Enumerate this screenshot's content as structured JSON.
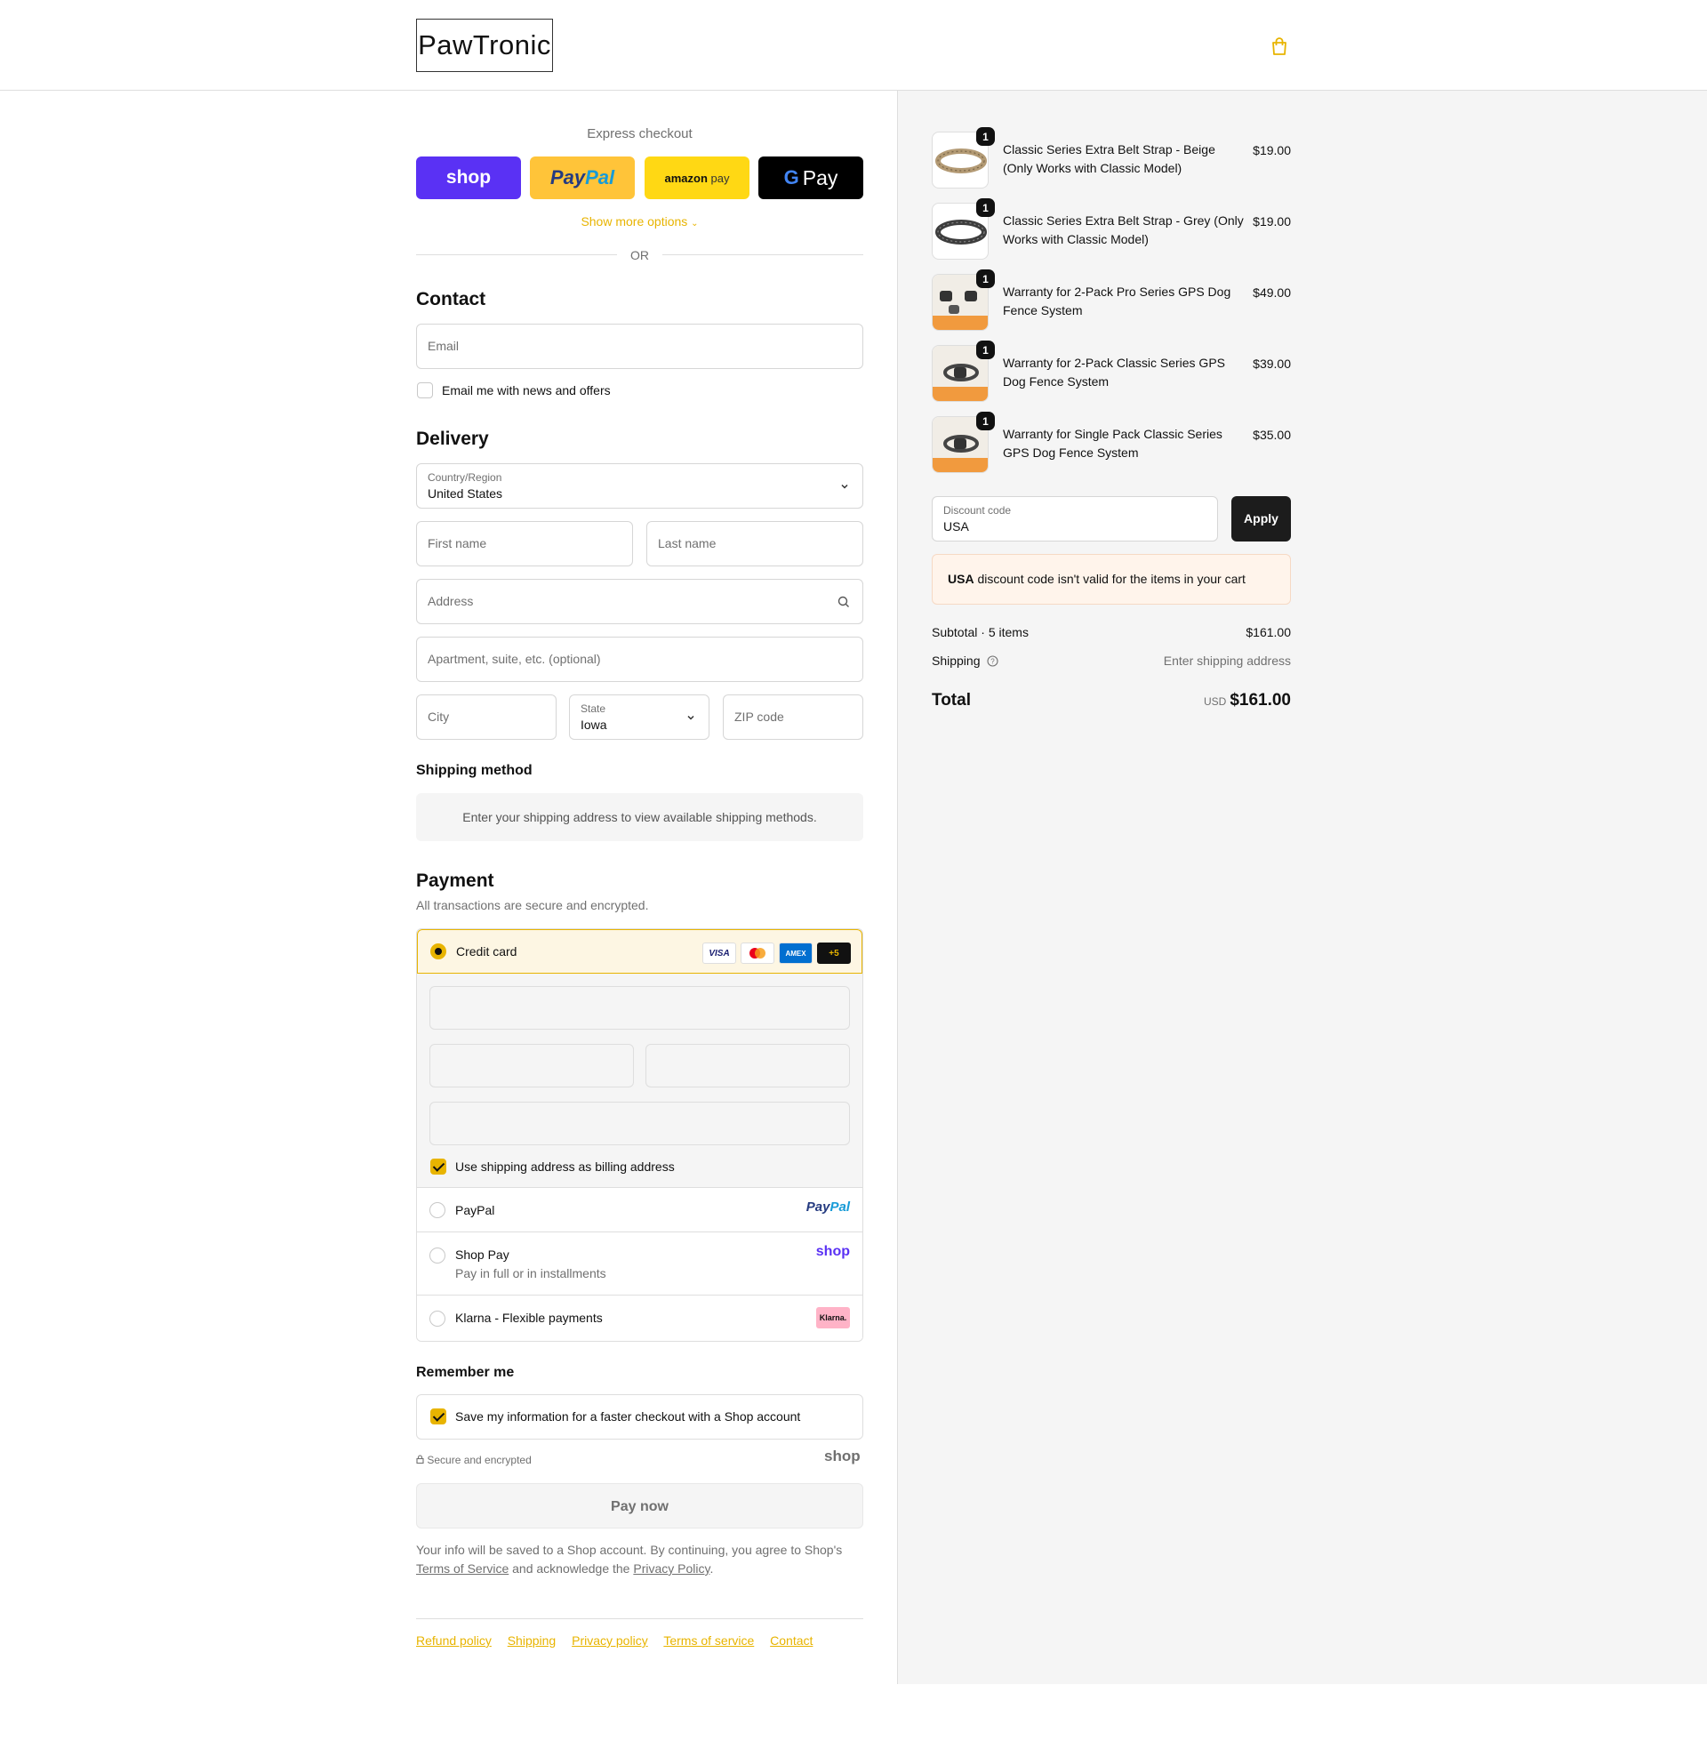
{
  "header": {
    "logo_text": "PawTronic",
    "cart_icon": "shopping-bag-icon"
  },
  "express": {
    "title": "Express checkout",
    "shop_label": "shop",
    "paypal_label_a": "Pay",
    "paypal_label_b": "Pal",
    "amazon_label_a": "amazon",
    "amazon_label_b": "pay",
    "gpay_label": "Pay",
    "more_options": "Show more options",
    "or": "OR"
  },
  "contact": {
    "heading": "Contact",
    "email_placeholder": "Email",
    "news_label": "Email me with news and offers"
  },
  "delivery": {
    "heading": "Delivery",
    "country_label": "Country/Region",
    "country_value": "United States",
    "first_name": "First name",
    "last_name": "Last name",
    "address": "Address",
    "apartment": "Apartment, suite, etc. (optional)",
    "city": "City",
    "state_label": "State",
    "state_value": "Iowa",
    "zip": "ZIP code"
  },
  "shipping_method": {
    "heading": "Shipping method",
    "message": "Enter your shipping address to view available shipping methods."
  },
  "payment": {
    "heading": "Payment",
    "subtitle": "All transactions are secure and encrypted.",
    "credit_card": "Credit card",
    "card_logos": [
      "VISA",
      "MC",
      "AMEX",
      "+5"
    ],
    "billing_same": "Use shipping address as billing address",
    "paypal": "PayPal",
    "paypal_logo_a": "Pay",
    "paypal_logo_b": "Pal",
    "shop_pay": "Shop Pay",
    "shop_pay_sub": "Pay in full or in installments",
    "shop_logo": "shop",
    "klarna": "Klarna - Flexible payments",
    "klarna_logo": "Klarna."
  },
  "remember": {
    "heading": "Remember me",
    "save_label": "Save my information for a faster checkout with a Shop account",
    "secure": "Secure and encrypted",
    "shop_logo": "shop"
  },
  "pay_now": "Pay now",
  "legal": {
    "part1": "Your info will be saved to a Shop account. By continuing, you agree to Shop's",
    "terms": "Terms of Service",
    "part2": "and acknowledge the",
    "privacy": "Privacy Policy",
    "part3": "."
  },
  "footer": [
    "Refund policy",
    "Shipping",
    "Privacy policy",
    "Terms of service",
    "Contact"
  ],
  "cart": {
    "items": [
      {
        "name": "Classic Series Extra Belt Strap - Beige (Only Works with Classic Model)",
        "price": "$19.00",
        "qty": "1"
      },
      {
        "name": "Classic Series Extra Belt Strap - Grey (Only Works with Classic Model)",
        "price": "$19.00",
        "qty": "1"
      },
      {
        "name": "Warranty for 2-Pack Pro Series GPS Dog Fence System",
        "price": "$49.00",
        "qty": "1"
      },
      {
        "name": "Warranty for 2-Pack Classic Series GPS Dog Fence System",
        "price": "$39.00",
        "qty": "1"
      },
      {
        "name": "Warranty for Single Pack Classic Series GPS Dog Fence System",
        "price": "$35.00",
        "qty": "1"
      }
    ],
    "discount_label": "Discount code",
    "discount_value": "USA",
    "apply": "Apply",
    "warning_code": "USA",
    "warning_text": "discount code isn't valid for the items in your cart",
    "subtotal_label": "Subtotal · 5 items",
    "subtotal": "$161.00",
    "shipping_label": "Shipping",
    "shipping_value": "Enter shipping address",
    "total_label": "Total",
    "currency": "USD",
    "total": "$161.00"
  },
  "colors": {
    "accent": "#e8b400",
    "shop_purple": "#5a31f4",
    "paypal_yellow": "#ffc439",
    "amazon_yellow": "#ffd814"
  }
}
